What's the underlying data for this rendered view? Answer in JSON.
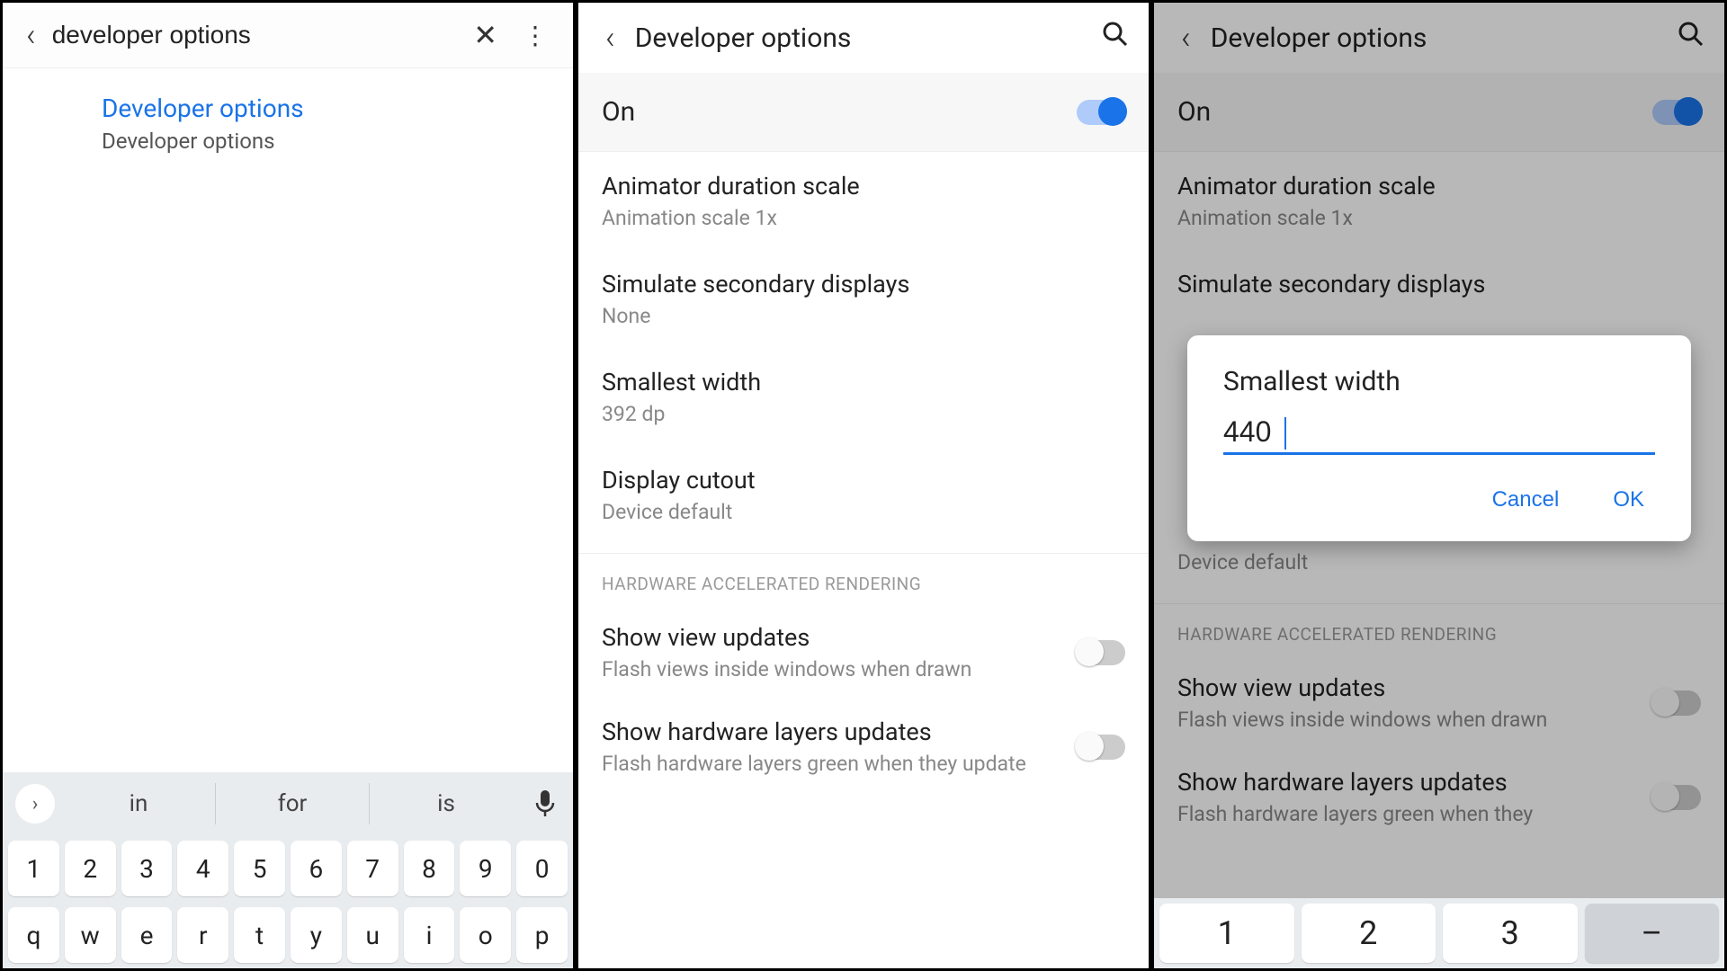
{
  "panel1": {
    "search_value": "developer options",
    "result_title": "Developer options",
    "result_sub": "Developer options",
    "suggestions": [
      "in",
      "for",
      "is"
    ],
    "num_row": [
      "1",
      "2",
      "3",
      "4",
      "5",
      "6",
      "7",
      "8",
      "9",
      "0"
    ],
    "letter_row": [
      "q",
      "w",
      "e",
      "r",
      "t",
      "y",
      "u",
      "i",
      "o",
      "p"
    ]
  },
  "panel2": {
    "title": "Developer options",
    "on_label": "On",
    "items": [
      {
        "title": "Animator duration scale",
        "sub": "Animation scale 1x"
      },
      {
        "title": "Simulate secondary displays",
        "sub": "None"
      },
      {
        "title": "Smallest width",
        "sub": "392 dp"
      },
      {
        "title": "Display cutout",
        "sub": "Device default"
      }
    ],
    "section": "HARDWARE ACCELERATED RENDERING",
    "toggles": [
      {
        "title": "Show view updates",
        "sub": "Flash views inside windows when drawn"
      },
      {
        "title": "Show hardware layers updates",
        "sub": "Flash hardware layers green when they update"
      }
    ]
  },
  "panel3": {
    "title": "Developer options",
    "on_label": "On",
    "items": [
      {
        "title": "Animator duration scale",
        "sub": "Animation scale 1x"
      },
      {
        "title": "Simulate secondary displays",
        "sub": ""
      }
    ],
    "cutout_sub": "Device default",
    "section": "HARDWARE ACCELERATED RENDERING",
    "toggles": [
      {
        "title": "Show view updates",
        "sub": "Flash views inside windows when drawn"
      },
      {
        "title": "Show hardware layers updates",
        "sub": "Flash hardware layers green when they"
      }
    ],
    "dialog": {
      "title": "Smallest width",
      "value": "440",
      "cancel": "Cancel",
      "ok": "OK"
    },
    "numpad": [
      "1",
      "2",
      "3",
      "–"
    ]
  }
}
